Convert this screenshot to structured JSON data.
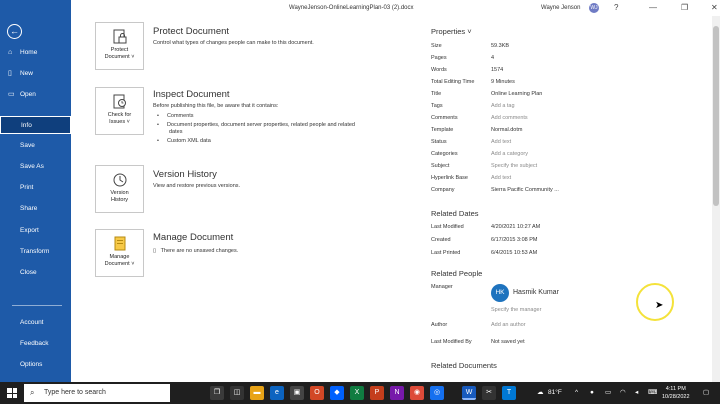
{
  "window": {
    "title": "WayneJenson-OnlineLearningPlan-03 (2).docx",
    "user_name": "Wayne Jenson",
    "user_initials": "WJ",
    "controls": [
      "?",
      "—",
      "❐",
      "✕"
    ]
  },
  "nav": {
    "back_label": "←",
    "items": [
      {
        "label": "Home",
        "icon": "home-icon"
      },
      {
        "label": "New",
        "icon": "new-document-icon"
      },
      {
        "label": "Open",
        "icon": "folder-icon"
      },
      {
        "label": "Info",
        "icon": ""
      },
      {
        "label": "Save",
        "icon": ""
      },
      {
        "label": "Save As",
        "icon": ""
      },
      {
        "label": "Print",
        "icon": ""
      },
      {
        "label": "Share",
        "icon": ""
      },
      {
        "label": "Export",
        "icon": ""
      },
      {
        "label": "Transform",
        "icon": ""
      },
      {
        "label": "Close",
        "icon": ""
      },
      {
        "label": "Account",
        "icon": ""
      },
      {
        "label": "Feedback",
        "icon": ""
      },
      {
        "label": "Options",
        "icon": ""
      }
    ],
    "selected": "Info"
  },
  "sections": {
    "protect": {
      "button_label_1": "Protect",
      "button_label_2": "Document ˅",
      "title": "Protect Document",
      "desc": "Control what types of changes people can make to this document."
    },
    "inspect": {
      "button_label_1": "Check for",
      "button_label_2": "Issues ˅",
      "title": "Inspect Document",
      "desc": "Before publishing this file, be aware that it contains:",
      "list": [
        "Comments",
        "Document properties, document server properties, related people and related",
        "dates",
        "Custom XML data"
      ]
    },
    "version": {
      "button_label_1": "Version",
      "button_label_2": "History",
      "title": "Version History",
      "desc": "View and restore previous versions."
    },
    "manage": {
      "button_label_1": "Manage",
      "button_label_2": "Document ˅",
      "title": "Manage Document",
      "desc": "There are no unsaved changes."
    }
  },
  "properties": {
    "header": "Properties ˅",
    "rows": [
      {
        "key": "Size",
        "value": "59.3KB",
        "hint": false
      },
      {
        "key": "Pages",
        "value": "4",
        "hint": false
      },
      {
        "key": "Words",
        "value": "1574",
        "hint": false
      },
      {
        "key": "Total Editing Time",
        "value": "9 Minutes",
        "hint": false
      },
      {
        "key": "Title",
        "value": "Online Learning Plan",
        "hint": false
      },
      {
        "key": "Tags",
        "value": "Add a tag",
        "hint": true
      },
      {
        "key": "Comments",
        "value": "Add comments",
        "hint": true
      },
      {
        "key": "Template",
        "value": "Normal.dotm",
        "hint": false
      },
      {
        "key": "Status",
        "value": "Add text",
        "hint": true
      },
      {
        "key": "Categories",
        "value": "Add a category",
        "hint": true
      },
      {
        "key": "Subject",
        "value": "Specify the subject",
        "hint": true
      },
      {
        "key": "Hyperlink Base",
        "value": "Add text",
        "hint": true
      },
      {
        "key": "Company",
        "value": "Sierra Pacific Community ...",
        "hint": false
      }
    ],
    "related_dates_header": "Related Dates",
    "dates": [
      {
        "key": "Last Modified",
        "value": "4/20/2021 10:27 AM"
      },
      {
        "key": "Created",
        "value": "6/17/2015 3:08 PM"
      },
      {
        "key": "Last Printed",
        "value": "6/4/2015 10:53 AM"
      }
    ],
    "related_people_header": "Related People",
    "manager_label": "Manager",
    "manager_initials": "HK",
    "manager_name": "Hasmik Kumar",
    "manager_hint": "Specify the manager",
    "author_label": "Author",
    "author_hint": "Add an author",
    "last_modified_by_label": "Last Modified By",
    "last_modified_by_value": "Not saved yet",
    "related_documents_header": "Related Documents"
  },
  "taskbar": {
    "search_placeholder": "Type here to search",
    "weather": "81°F",
    "clock_time": "4:11 PM",
    "clock_date": "10/28/2022"
  }
}
